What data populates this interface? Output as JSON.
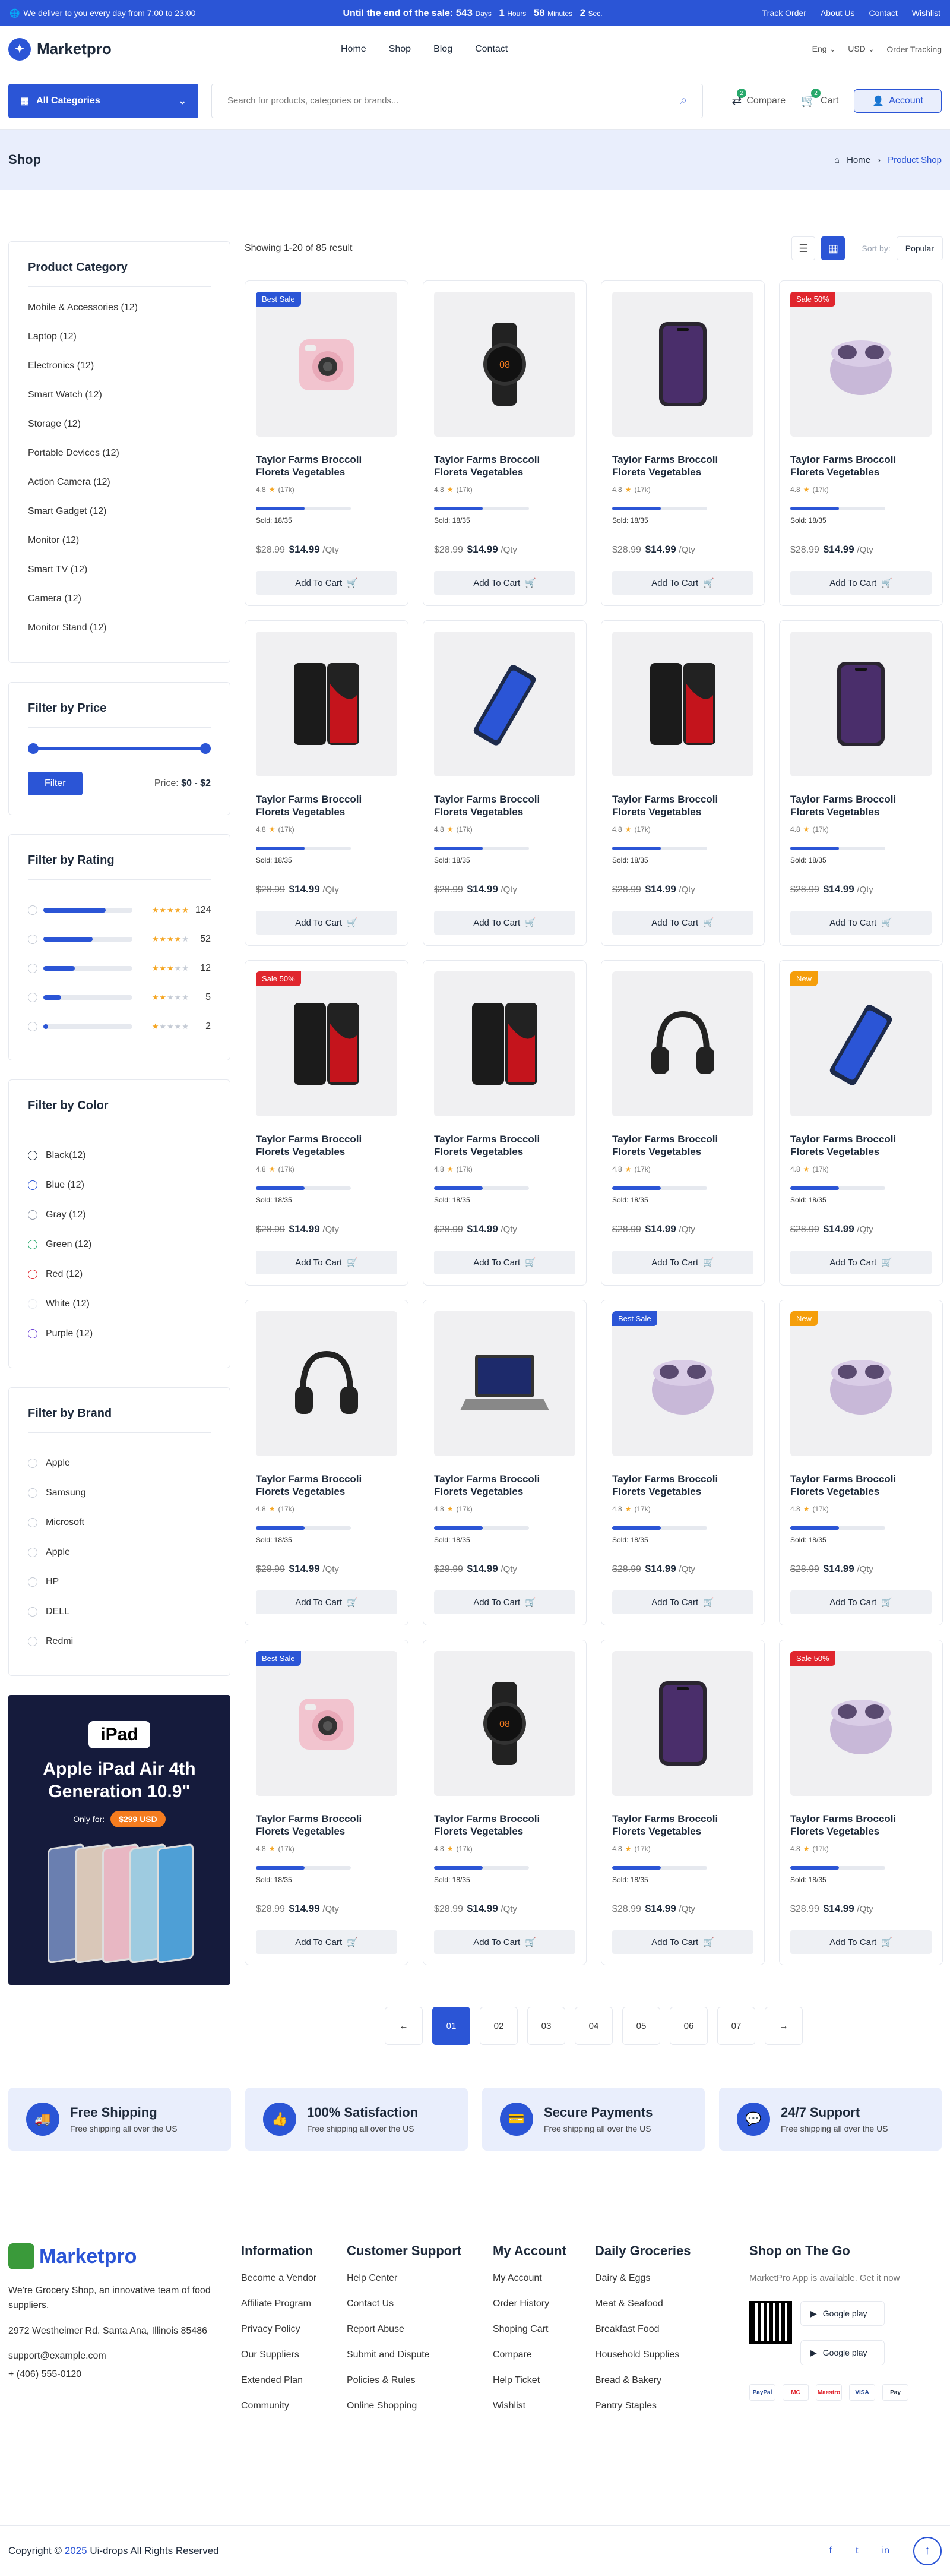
{
  "topbar": {
    "deliver": "We deliver to you every day from 7:00 to 23:00",
    "sale_prefix": "Until the end of the sale:",
    "days": "543",
    "days_lbl": "Days",
    "hours": "1",
    "hours_lbl": "Hours",
    "minutes": "58",
    "minutes_lbl": "Minutes",
    "seconds": "2",
    "seconds_lbl": "Sec.",
    "links": [
      "Track Order",
      "About Us",
      "Contact",
      "Wishlist"
    ]
  },
  "header": {
    "logo": "Marketpro",
    "nav": [
      "Home",
      "Shop",
      "Blog",
      "Contact"
    ],
    "lang": "Eng",
    "currency": "USD",
    "order_tracking": "Order Tracking"
  },
  "searchbar": {
    "all_categories": "All Categories",
    "placeholder": "Search for products, categories or brands...",
    "compare": "Compare",
    "compare_count": "2",
    "cart": "Cart",
    "cart_count": "2",
    "account": "Account"
  },
  "page": {
    "title": "Shop",
    "crumb_home": "Home",
    "crumb_current": "Product Shop"
  },
  "sidebar": {
    "category_title": "Product Category",
    "categories": [
      "Mobile & Accessories (12)",
      "Laptop (12)",
      "Electronics (12)",
      "Smart Watch (12)",
      "Storage (12)",
      "Portable Devices (12)",
      "Action Camera (12)",
      "Smart Gadget (12)",
      "Monitor (12)",
      "Smart TV (12)",
      "Camera (12)",
      "Monitor Stand (12)"
    ],
    "price_title": "Filter by Price",
    "filter_btn": "Filter",
    "price_label": "Price:",
    "price_value": "$0 - $2",
    "rating_title": "Filter by Rating",
    "ratings": [
      {
        "stars": 5,
        "count": "124",
        "fill": 0.7
      },
      {
        "stars": 4,
        "count": "52",
        "fill": 0.55
      },
      {
        "stars": 3,
        "count": "12",
        "fill": 0.35
      },
      {
        "stars": 2,
        "count": "5",
        "fill": 0.2
      },
      {
        "stars": 1,
        "count": "2",
        "fill": 0.05
      }
    ],
    "color_title": "Filter by Color",
    "colors": [
      {
        "name": "Black(12)",
        "hex": "#1e2a3b"
      },
      {
        "name": "Blue (12)",
        "hex": "#2b55d6"
      },
      {
        "name": "Gray (12)",
        "hex": "#8a93a3"
      },
      {
        "name": "Green (12)",
        "hex": "#27a86b"
      },
      {
        "name": "Red (12)",
        "hex": "#e0262e"
      },
      {
        "name": "White (12)",
        "hex": "#ffffff"
      },
      {
        "name": "Purple (12)",
        "hex": "#6b3fd6"
      }
    ],
    "brand_title": "Filter by Brand",
    "brands": [
      "Apple",
      "Samsung",
      "Microsoft",
      "Apple",
      "HP",
      "DELL",
      "Redmi"
    ],
    "banner": {
      "brand": "iPad",
      "headline": "Apple iPad Air 4th Generation 10.9\"",
      "only_for": "Only for:",
      "price": "$299 USD"
    }
  },
  "toolbar": {
    "result": "Showing 1-20 of 85 result",
    "sort_label": "Sort by:",
    "sort_value": "Popular"
  },
  "product": {
    "title": "Taylor Farms Broccoli Florets Vegetables",
    "rating": "4.8",
    "reviews": "(17k)",
    "sold": "Sold: 18/35",
    "sold_fill": 0.51,
    "old_price": "$28.99",
    "price": "$14.99",
    "unit": "/Qty",
    "add_to_cart": "Add To Cart"
  },
  "products": [
    {
      "tag": "Best Sale",
      "tagc": "blue",
      "img": "camera"
    },
    {
      "tag": "",
      "tagc": "",
      "img": "watch"
    },
    {
      "tag": "",
      "tagc": "",
      "img": "iphone"
    },
    {
      "tag": "Sale 50%",
      "tagc": "red",
      "img": "buds"
    },
    {
      "tag": "",
      "tagc": "",
      "img": "phone2"
    },
    {
      "tag": "",
      "tagc": "",
      "img": "phoneblue"
    },
    {
      "tag": "",
      "tagc": "",
      "img": "phone2"
    },
    {
      "tag": "",
      "tagc": "",
      "img": "iphone"
    },
    {
      "tag": "Sale 50%",
      "tagc": "red",
      "img": "phone2"
    },
    {
      "tag": "",
      "tagc": "",
      "img": "phone2"
    },
    {
      "tag": "",
      "tagc": "",
      "img": "headphone"
    },
    {
      "tag": "New",
      "tagc": "orange",
      "img": "phoneblue"
    },
    {
      "tag": "",
      "tagc": "",
      "img": "headphone"
    },
    {
      "tag": "",
      "tagc": "",
      "img": "laptop"
    },
    {
      "tag": "Best Sale",
      "tagc": "blue",
      "img": "buds"
    },
    {
      "tag": "New",
      "tagc": "orange",
      "img": "buds"
    },
    {
      "tag": "Best Sale",
      "tagc": "blue",
      "img": "camera"
    },
    {
      "tag": "",
      "tagc": "",
      "img": "watch"
    },
    {
      "tag": "",
      "tagc": "",
      "img": "iphone"
    },
    {
      "tag": "Sale 50%",
      "tagc": "red",
      "img": "buds"
    }
  ],
  "pagination": {
    "prev": "←",
    "pages": [
      "01",
      "02",
      "03",
      "04",
      "05",
      "06",
      "07"
    ],
    "next": "→"
  },
  "features": [
    {
      "title": "Free Shipping",
      "text": "Free shipping all over the US"
    },
    {
      "title": "100% Satisfaction",
      "text": "Free shipping all over the US"
    },
    {
      "title": "Secure Payments",
      "text": "Free shipping all over the US"
    },
    {
      "title": "24/7 Support",
      "text": "Free shipping all over the US"
    }
  ],
  "footer": {
    "logo": "Marketpro",
    "about": "We're Grocery Shop, an innovative team of food suppliers.",
    "address": "2972 Westheimer Rd. Santa Ana, Illinois 85486",
    "email": "support@example.com",
    "phone": "+ (406) 555-0120",
    "cols": [
      {
        "title": "Information",
        "links": [
          "Become a Vendor",
          "Affiliate Program",
          "Privacy Policy",
          "Our Suppliers",
          "Extended Plan",
          "Community"
        ]
      },
      {
        "title": "Customer Support",
        "links": [
          "Help Center",
          "Contact Us",
          "Report Abuse",
          "Submit and Dispute",
          "Policies & Rules",
          "Online Shopping"
        ]
      },
      {
        "title": "My Account",
        "links": [
          "My Account",
          "Order History",
          "Shoping Cart",
          "Compare",
          "Help Ticket",
          "Wishlist"
        ]
      },
      {
        "title": "Daily Groceries",
        "links": [
          "Dairy & Eggs",
          "Meat & Seafood",
          "Breakfast Food",
          "Household Supplies",
          "Bread & Bakery",
          "Pantry Staples"
        ]
      }
    ],
    "app_title": "Shop on The Go",
    "app_text": "MarketPro App is available. Get it now",
    "store1": "Google play",
    "store2": "Google play",
    "pays": [
      "PayPal",
      "MC",
      "Maestro",
      "VISA",
      "Pay"
    ]
  },
  "copyright": {
    "prefix": "Copyright ©",
    "year": "2025",
    "suffix": "Ui-drops All Rights Reserved"
  },
  "colors": {
    "accent": "#2b55d6",
    "tint": "#e9eefc"
  }
}
